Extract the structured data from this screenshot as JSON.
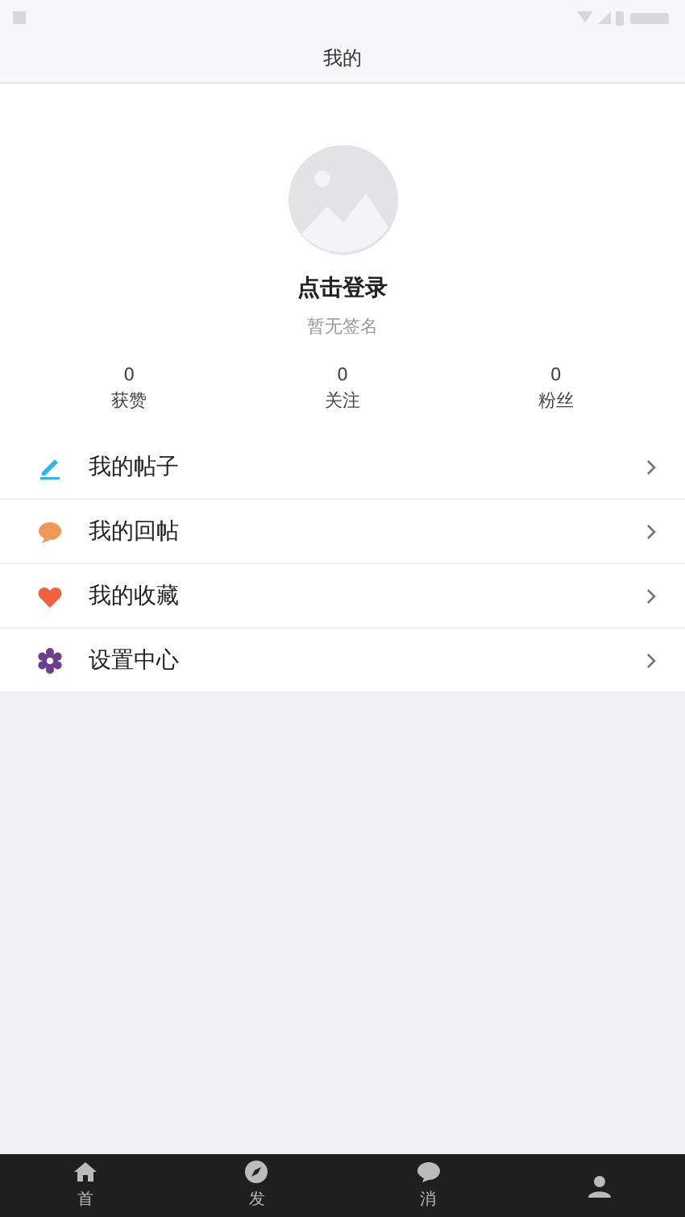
{
  "header": {
    "title": "我的"
  },
  "profile": {
    "name": "点击登录",
    "signature": "暂无签名"
  },
  "stats": [
    {
      "value": "0",
      "label": "获赞"
    },
    {
      "value": "0",
      "label": "关注"
    },
    {
      "value": "0",
      "label": "粉丝"
    }
  ],
  "menu": [
    {
      "kind": "pencil",
      "color": "#29b6e8",
      "label": "我的帖子"
    },
    {
      "kind": "chat",
      "color": "#f0975a",
      "label": "我的回帖"
    },
    {
      "kind": "heart",
      "color": "#f2603f",
      "label": "我的收藏"
    },
    {
      "kind": "gear",
      "color": "#6b3f8c",
      "label": "设置中心"
    }
  ],
  "tabbar": [
    {
      "kind": "home",
      "label": "首"
    },
    {
      "kind": "compass",
      "label": "发"
    },
    {
      "kind": "chat",
      "label": "消"
    },
    {
      "kind": "person"
    }
  ]
}
